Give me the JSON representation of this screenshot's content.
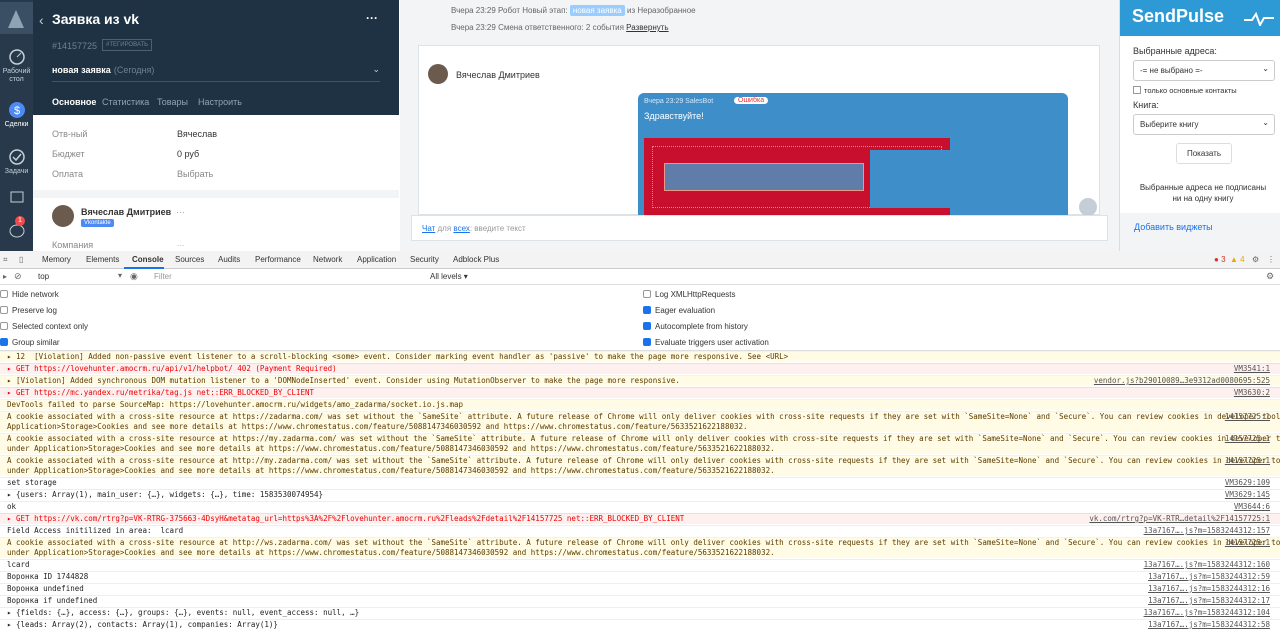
{
  "nav": {
    "items": [
      {
        "label": "Рабочий стол"
      },
      {
        "label": "Сделки"
      },
      {
        "label": "Задачи"
      },
      {
        "label": ""
      },
      {
        "label": ""
      }
    ],
    "badge": "1"
  },
  "lead": {
    "title": "Заявка из vk",
    "id": "#14157725",
    "tag_btn": "#ТЕГИРОВАТЬ",
    "stage": "новая заявка",
    "stage_date": "(Сегодня)",
    "tabs": [
      "Основное",
      "Статистика",
      "Товары",
      "Настроить"
    ],
    "rows": [
      {
        "label": "Отв-ный",
        "value": "Вячеслав"
      },
      {
        "label": "Бюджет",
        "value": "0 руб"
      },
      {
        "label": "Оплата",
        "value": "Выбрать"
      }
    ],
    "contact": {
      "name": "Вячеслав Дмитриев",
      "source": "Vkontakte",
      "company_label": "Компания"
    }
  },
  "feed": {
    "event1": {
      "time": "Вчера 23:29 Робот",
      "text": "Новый этап:",
      "tag": "новая заявка",
      "from": "из Неразобранное"
    },
    "event2": {
      "time": "Вчера 23:29",
      "text": "Смена ответственного: 2 события",
      "link": "Развернуть"
    },
    "author": "Вячеслав Дмитриев",
    "bot": {
      "time": "Вчера 23:29 SalesBot",
      "status": "Ошибка",
      "msg": "Здравствуйте!"
    },
    "input": {
      "chat": "Чат",
      "for": "для",
      "all": "всех",
      "placeholder": ": введите текст"
    }
  },
  "sendpulse": {
    "logo": "SendPulse",
    "addr_label": "Выбранные адреса:",
    "addr_select": "-= не выбрано =-",
    "only_main": "только основные контакты",
    "book_label": "Книга:",
    "book_select": "Выберите книгу",
    "show_btn": "Показать",
    "note": "Выбранные адреса не подписаны ни на одну книгу",
    "add_widgets": "Добавить виджеты"
  },
  "devtools": {
    "tabs": [
      "Memory",
      "Elements",
      "Console",
      "Sources",
      "Audits",
      "Performance",
      "Network",
      "Application",
      "Security",
      "Adblock Plus"
    ],
    "active_tab": "Console",
    "errors": "3",
    "warnings": "4",
    "context": "top",
    "filter_placeholder": "Filter",
    "levels": "All levels ▾",
    "settings_left": [
      {
        "label": "Hide network",
        "checked": false
      },
      {
        "label": "Preserve log",
        "checked": false
      },
      {
        "label": "Selected context only",
        "checked": false
      },
      {
        "label": "Group similar",
        "checked": true
      }
    ],
    "settings_right": [
      {
        "label": "Log XMLHttpRequests",
        "checked": false
      },
      {
        "label": "Eager evaluation",
        "checked": true
      },
      {
        "label": "Autocomplete from history",
        "checked": true
      },
      {
        "label": "Evaluate triggers user activation",
        "checked": true
      }
    ]
  },
  "console": {
    "lines": [
      {
        "type": "warn",
        "text": "▸ 12  [Violation] Added non-passive event listener to a scroll-blocking <some> event. Consider marking event handler as 'passive' to make the page more responsive. See <URL>",
        "src": ""
      },
      {
        "type": "err",
        "text": "▸ GET https://lovehunter.amocrm.ru/api/v1/helpbot/ 402 (Payment Required)",
        "src": "VM3541:1"
      },
      {
        "type": "warn",
        "text": "▸ [Violation] Added synchronous DOM mutation listener to a 'DOMNodeInserted' event. Consider using MutationObserver to make the page more responsive.",
        "src": "vendor.js?b29010089…3e9312ad0080695:525"
      },
      {
        "type": "err",
        "text": "▸ GET https://mc.yandex.ru/metrika/tag.js net::ERR_BLOCKED_BY_CLIENT",
        "src": "VM3630:2"
      },
      {
        "type": "warn",
        "text": "DevTools failed to parse SourceMap: https://lovehunter.amocrm.ru/widgets/amo_zadarma/socket.io.js.map",
        "src": ""
      },
      {
        "type": "warn2",
        "text": "A cookie associated with a cross-site resource at https://zadarma.com/ was set without the `SameSite` attribute. A future release of Chrome will only deliver cookies with cross-site requests if they are set with `SameSite=None` and `Secure`. You can review cookies in developer tools under\nApplication>Storage>Cookies and see more details at https://www.chromestatus.com/feature/5088147346030592 and https://www.chromestatus.com/feature/5633521622188032.",
        "src": "14157725:1"
      },
      {
        "type": "warn2",
        "text": "A cookie associated with a cross-site resource at https://my.zadarma.com/ was set without the `SameSite` attribute. A future release of Chrome will only deliver cookies with cross-site requests if they are set with `SameSite=None` and `Secure`. You can review cookies in developer tools\nunder Application>Storage>Cookies and see more details at https://www.chromestatus.com/feature/5088147346030592 and https://www.chromestatus.com/feature/5633521622188032.",
        "src": "14157725:1"
      },
      {
        "type": "warn2",
        "text": "A cookie associated with a cross-site resource at http://my.zadarma.com/ was set without the `SameSite` attribute. A future release of Chrome will only deliver cookies with cross-site requests if they are set with `SameSite=None` and `Secure`. You can review cookies in developer tools\nunder Application>Storage>Cookies and see more details at https://www.chromestatus.com/feature/5088147346030592 and https://www.chromestatus.com/feature/5633521622188032.",
        "src": "14157725:1"
      },
      {
        "type": "info",
        "text": "set storage",
        "src": "VM3629:109"
      },
      {
        "type": "info",
        "text": "▸ {users: Array(1), main_user: {…}, widgets: {…}, time: 1583530074954}",
        "src": "VM3629:145"
      },
      {
        "type": "info",
        "text": "ok",
        "src": "VM3644:6"
      },
      {
        "type": "err",
        "text": "▸ GET https://vk.com/rtrg?p=VK-RTRG-375663-4DsyH&metatag_url=https%3A%2F%2Flovehunter.amocrm.ru%2Fleads%2Fdetail%2F14157725 net::ERR_BLOCKED_BY_CLIENT",
        "src": "vk.com/rtrg?p=VK-RTR…detail%2F14157725:1"
      },
      {
        "type": "info",
        "text": "Field Access initilized in area:  lcard",
        "src": "13a7167….js?m=1583244312:157"
      },
      {
        "type": "warn2",
        "text": "A cookie associated with a cross-site resource at http://ws.zadarma.com/ was set without the `SameSite` attribute. A future release of Chrome will only deliver cookies with cross-site requests if they are set with `SameSite=None` and `Secure`. You can review cookies in developer tools\nunder Application>Storage>Cookies and see more details at https://www.chromestatus.com/feature/5088147346030592 and https://www.chromestatus.com/feature/5633521622188032.",
        "src": "14157725:1"
      },
      {
        "type": "info",
        "text": "lcard",
        "src": "13a7167….js?m=1583244312:160"
      },
      {
        "type": "info",
        "text": "Воронка ID 1744828",
        "src": "13a7167….js?m=1583244312:59"
      },
      {
        "type": "info",
        "text": "Воронка undefined",
        "src": "13a7167….js?m=1583244312:16"
      },
      {
        "type": "info",
        "text": "Воронка if undefined",
        "src": "13a7167….js?m=1583244312:17"
      },
      {
        "type": "info",
        "text": "▸ {fields: {…}, access: {…}, groups: {…}, events: null, event_access: null, …}",
        "src": "13a7167….js?m=1583244312:104"
      },
      {
        "type": "info",
        "text": "▸ {leads: Array(2), contacts: Array(1), companies: Array(1)}",
        "src": "13a7167….js?m=1583244312:58"
      }
    ]
  }
}
